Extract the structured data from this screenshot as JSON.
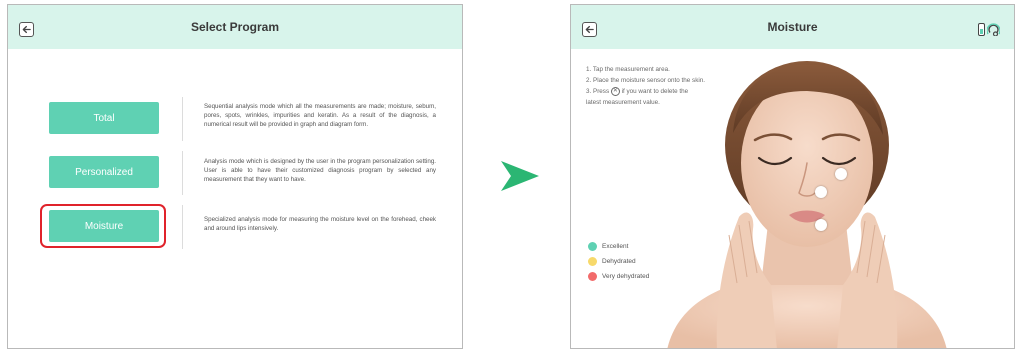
{
  "left_screen": {
    "title": "Select Program",
    "programs": [
      {
        "label": "Total",
        "description": "Sequential analysis mode which all the measurements are made; moisture, sebum, pores, spots, wrinkles, impurities and keratin. As a result of the diagnosis, a numerical result will be provided in graph and diagram form."
      },
      {
        "label": "Personalized",
        "description": "Analysis mode which is designed by the user in the program personalization setting. User is able to have their customized diagnosis program by selected any measurement that they want to have."
      },
      {
        "label": "Moisture",
        "description": "Specialized analysis mode for measuring the moisture level on the forehead, cheek and around lips intensively."
      }
    ],
    "selected_program": "Moisture"
  },
  "right_screen": {
    "title": "Moisture",
    "instructions": {
      "step1": "1. Tap the measurement area.",
      "step2": "2. Place the moisture sensor onto the skin.",
      "step3_before": "3. Press",
      "step3_after": "if you want to delete the",
      "step3_cont": "latest measurement value."
    },
    "legend": [
      {
        "label": "Excellent",
        "color": "#5fd1b3"
      },
      {
        "label": "Dehydrated",
        "color": "#f7d96b"
      },
      {
        "label": "Very dehydrated",
        "color": "#f26b6b"
      }
    ]
  },
  "colors": {
    "accent": "#5fd1b3",
    "header_bg": "#d8f4eb",
    "selection": "#e0232b",
    "arrow": "#2bb673"
  },
  "icons": {
    "back": "arrow-left-icon",
    "sensor": "sensor-connected-icon",
    "delete": "x-circle-icon",
    "transition": "arrow-right-icon"
  }
}
